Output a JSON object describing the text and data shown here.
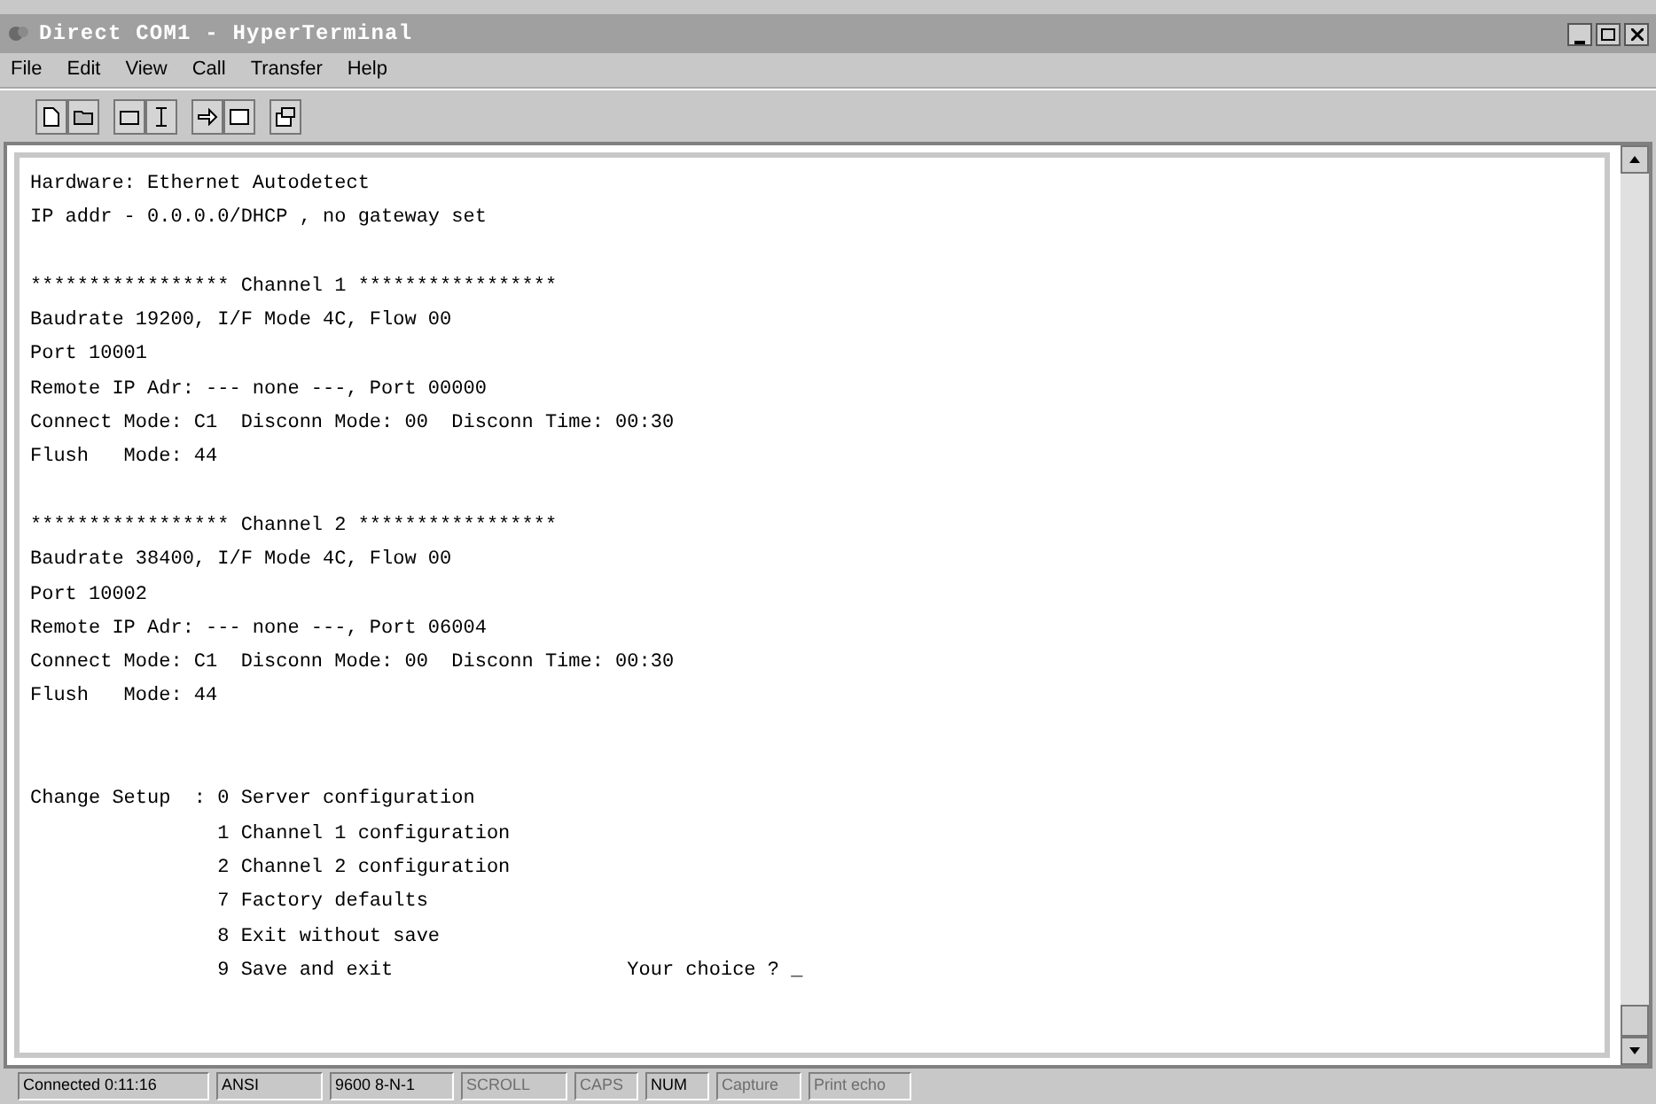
{
  "window": {
    "title": "Direct COM1 - HyperTerminal"
  },
  "menu": [
    "File",
    "Edit",
    "View",
    "Call",
    "Transfer",
    "Help"
  ],
  "terminal": {
    "blocks": [
      {
        "lines": [
          "Hardware: Ethernet Autodetect",
          "IP addr - 0.0.0.0/DHCP , no gateway set"
        ]
      },
      {
        "lines": [
          "***************** Channel 1 *****************",
          "Baudrate 19200, I/F Mode 4C, Flow 00",
          "Port 10001",
          "Remote IP Adr: --- none ---, Port 00000",
          "Connect Mode: C1  Disconn Mode: 00  Disconn Time: 00:30",
          "Flush   Mode: 44"
        ]
      },
      {
        "lines": [
          "***************** Channel 2 *****************",
          "Baudrate 38400, I/F Mode 4C, Flow 00",
          "Port 10002",
          "Remote IP Adr: --- none ---, Port 06004",
          "Connect Mode: C1  Disconn Mode: 00  Disconn Time: 00:30",
          "Flush   Mode: 44"
        ]
      },
      {
        "lines": [
          "Change Setup  : 0 Server configuration",
          "                1 Channel 1 configuration",
          "                2 Channel 2 configuration",
          "                7 Factory defaults",
          "                8 Exit without save",
          "                9 Save and exit                    Your choice ? _"
        ]
      }
    ]
  },
  "status_bar": [
    {
      "text": "Connected 0:11:16",
      "disabled": false
    },
    {
      "text": "ANSI",
      "disabled": false
    },
    {
      "text": "9600 8-N-1",
      "disabled": false
    },
    {
      "text": "SCROLL",
      "disabled": true
    },
    {
      "text": "CAPS",
      "disabled": true
    },
    {
      "text": "NUM",
      "disabled": false
    },
    {
      "text": "Capture",
      "disabled": true
    },
    {
      "text": "Print echo",
      "disabled": true
    }
  ]
}
